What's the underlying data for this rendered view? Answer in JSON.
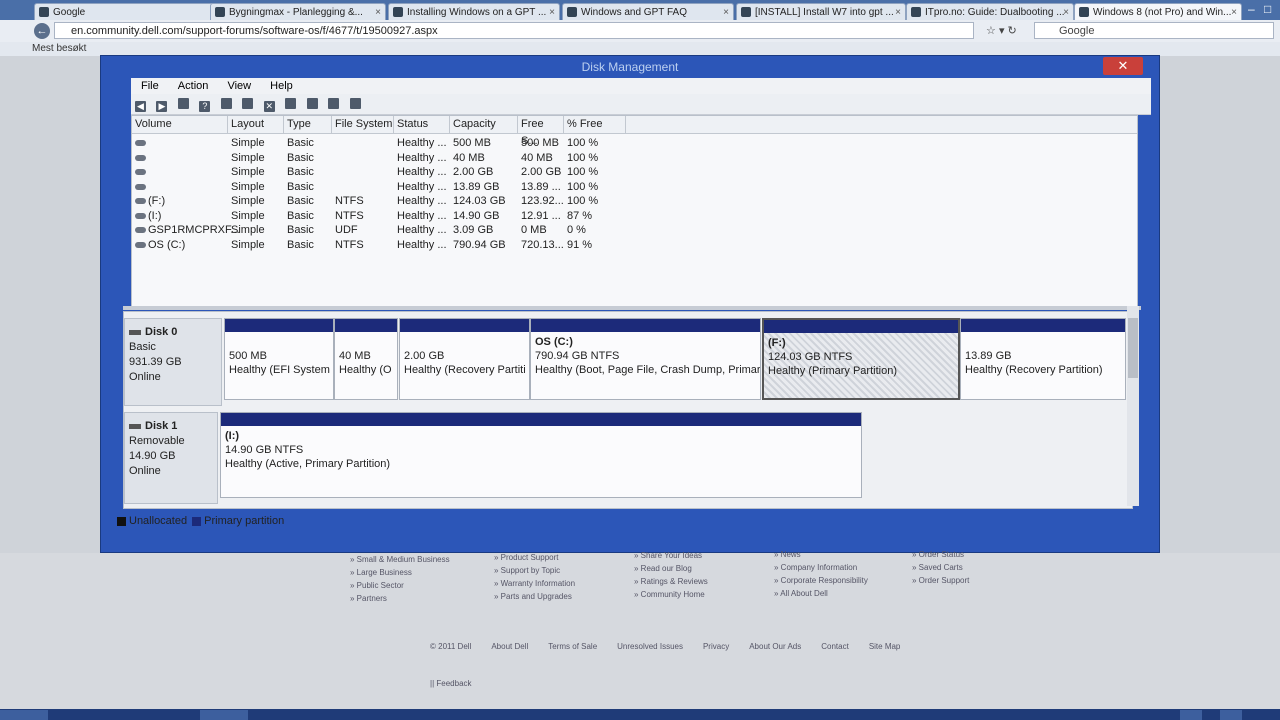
{
  "browser": {
    "tabs": [
      {
        "label": "Google"
      },
      {
        "label": "Bygningmax - Planlegging &..."
      },
      {
        "label": "Installing Windows on a GPT ..."
      },
      {
        "label": "Windows and GPT FAQ"
      },
      {
        "label": "[INSTALL] Install W7 into gpt ..."
      },
      {
        "label": "ITpro.no: Guide: Dualbooting ..."
      },
      {
        "label": "Windows 8 (not Pro) and Win..."
      }
    ],
    "url": "en.community.dell.com/support-forums/software-os/f/4677/t/19500927.aspx",
    "search_placeholder": "Google",
    "bookmarks_label": "Mest besøkt"
  },
  "dm": {
    "title": "Disk Management",
    "close_label": "✕",
    "menu": [
      "File",
      "Action",
      "View",
      "Help"
    ],
    "columns": [
      "Volume",
      "Layout",
      "Type",
      "File System",
      "Status",
      "Capacity",
      "Free S...",
      "% Free"
    ],
    "volumes": [
      {
        "volume": "",
        "layout": "Simple",
        "type": "Basic",
        "fs": "",
        "status": "Healthy ...",
        "capacity": "500 MB",
        "free": "500 MB",
        "pct": "100 %"
      },
      {
        "volume": "",
        "layout": "Simple",
        "type": "Basic",
        "fs": "",
        "status": "Healthy ...",
        "capacity": "40 MB",
        "free": "40 MB",
        "pct": "100 %"
      },
      {
        "volume": "",
        "layout": "Simple",
        "type": "Basic",
        "fs": "",
        "status": "Healthy ...",
        "capacity": "2.00 GB",
        "free": "2.00 GB",
        "pct": "100 %"
      },
      {
        "volume": "",
        "layout": "Simple",
        "type": "Basic",
        "fs": "",
        "status": "Healthy ...",
        "capacity": "13.89 GB",
        "free": "13.89 ...",
        "pct": "100 %"
      },
      {
        "volume": "(F:)",
        "layout": "Simple",
        "type": "Basic",
        "fs": "NTFS",
        "status": "Healthy ...",
        "capacity": "124.03 GB",
        "free": "123.92...",
        "pct": "100 %"
      },
      {
        "volume": "(I:)",
        "layout": "Simple",
        "type": "Basic",
        "fs": "NTFS",
        "status": "Healthy ...",
        "capacity": "14.90 GB",
        "free": "12.91 ...",
        "pct": "87 %"
      },
      {
        "volume": "GSP1RMCPRXF...",
        "layout": "Simple",
        "type": "Basic",
        "fs": "UDF",
        "status": "Healthy ...",
        "capacity": "3.09 GB",
        "free": "0 MB",
        "pct": "0 %"
      },
      {
        "volume": "OS (C:)",
        "layout": "Simple",
        "type": "Basic",
        "fs": "NTFS",
        "status": "Healthy ...",
        "capacity": "790.94 GB",
        "free": "720.13...",
        "pct": "91 %"
      }
    ],
    "disk0": {
      "name": "Disk 0",
      "kind": "Basic",
      "size": "931.39 GB",
      "state": "Online",
      "partitions": [
        {
          "title": "",
          "size": "500 MB",
          "status": "Healthy (EFI System"
        },
        {
          "title": "",
          "size": "40 MB",
          "status": "Healthy (O"
        },
        {
          "title": "",
          "size": "2.00 GB",
          "status": "Healthy (Recovery Partiti"
        },
        {
          "title": "OS  (C:)",
          "size": "790.94 GB NTFS",
          "status": "Healthy (Boot, Page File, Crash Dump, Primary"
        },
        {
          "title": "(F:)",
          "size": "124.03 GB NTFS",
          "status": "Healthy (Primary Partition)"
        },
        {
          "title": "",
          "size": "13.89 GB",
          "status": "Healthy (Recovery Partition)"
        }
      ]
    },
    "disk1": {
      "name": "Disk 1",
      "kind": "Removable",
      "size": "14.90 GB",
      "state": "Online",
      "partitions": [
        {
          "title": "(I:)",
          "size": "14.90 GB NTFS",
          "status": "Healthy (Active, Primary Partition)"
        }
      ]
    },
    "legend": {
      "unallocated": "Unallocated",
      "primary": "Primary partition"
    },
    "colors": {
      "primary": "#1c2a7a",
      "unallocated": "#111111"
    }
  },
  "footer": {
    "col1": [
      "Small & Medium Business",
      "Large Business",
      "Public Sector",
      "Partners"
    ],
    "col2": [
      "Product Support",
      "Support by Topic",
      "Warranty Information",
      "Parts and Upgrades"
    ],
    "col3": [
      "Share Your Ideas",
      "Read our Blog",
      "Ratings & Reviews",
      "Community Home"
    ],
    "col4": [
      "News",
      "Company Information",
      "Corporate Responsibility",
      "All About Dell"
    ],
    "col5": [
      "Order Status",
      "Saved Carts",
      "Order Support"
    ],
    "links": [
      "© 2011 Dell",
      "About Dell",
      "Terms of Sale",
      "Unresolved Issues",
      "Privacy",
      "About Our Ads",
      "Contact",
      "Site Map"
    ],
    "feedback": "Feedback"
  }
}
